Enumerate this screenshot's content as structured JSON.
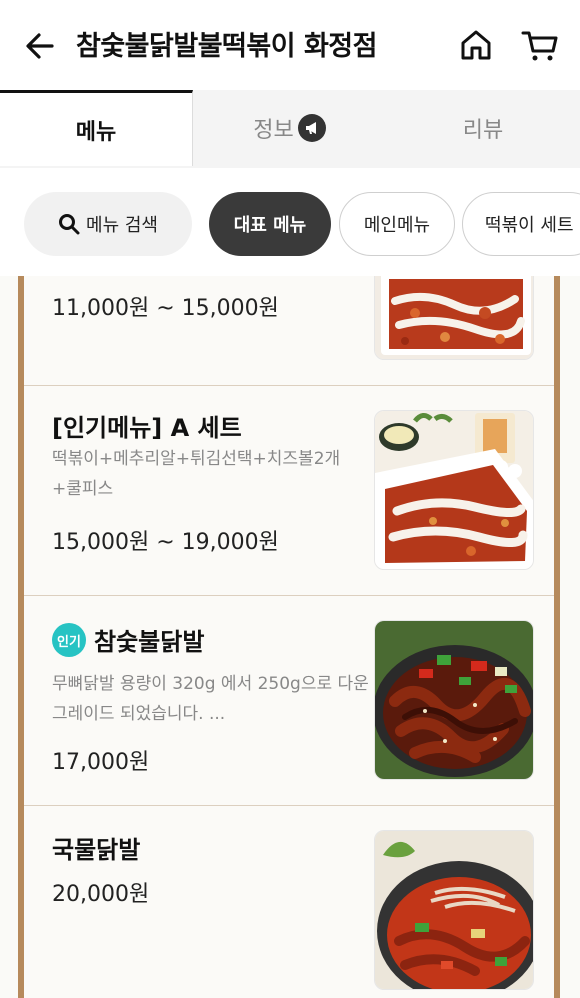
{
  "header": {
    "title": "참숯불닭발불떡볶이 화정점",
    "back_icon": "arrow-left-icon",
    "home_icon": "home-icon",
    "cart_icon": "cart-icon"
  },
  "tabs": [
    {
      "label": "메뉴",
      "active": true
    },
    {
      "label": "정보",
      "active": false,
      "icon": "megaphone-icon"
    },
    {
      "label": "리뷰",
      "active": false
    }
  ],
  "chips": {
    "search": "메뉴 검색",
    "items": [
      {
        "label": "대표 메뉴",
        "selected": true
      },
      {
        "label": "메인메뉴",
        "selected": false
      },
      {
        "label": "떡볶이 세트",
        "selected": false
      }
    ]
  },
  "menu_items": [
    {
      "name": "",
      "description": "",
      "price": "11,000원 ~ 15,000원"
    },
    {
      "name": "[인기메뉴] A 세트",
      "description": "떡볶이+메추리알+튀김선택+치즈볼2개+쿨피스",
      "price": "15,000원 ~ 19,000원"
    },
    {
      "badge": "인기",
      "name": "참숯불닭발",
      "description": "무뼈닭발 용량이 320g 에서 250g으로 다운그레이드 되었습니다. ...",
      "price": "17,000원"
    },
    {
      "name": "국물닭발",
      "description": "",
      "price": "20,000원"
    }
  ],
  "colors": {
    "frame": "#b68a5c",
    "badge": "#27c3c3",
    "chip_selected": "#3a3a3a"
  }
}
